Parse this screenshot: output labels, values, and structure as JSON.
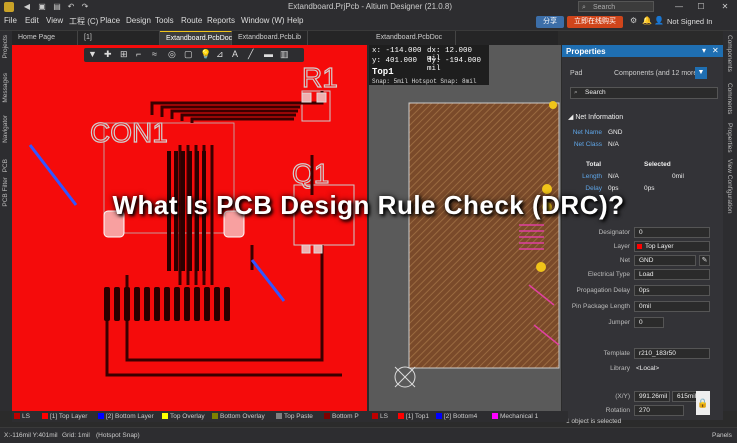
{
  "window": {
    "title": "Extandboard.PrjPcb - Altium Designer (21.0.8)",
    "search_placeholder": "Search"
  },
  "menus": [
    "File",
    "Edit",
    "View",
    "工程 (C)",
    "Place",
    "Design",
    "Tools",
    "Route",
    "Reports",
    "Window (W)",
    "Help"
  ],
  "header_buttons": {
    "share": "分享",
    "online": "立即在线购买",
    "signin": "Not Signed In"
  },
  "tabs": [
    {
      "label": "Home Page"
    },
    {
      "label": "[1] Extandboard.SchDoc *"
    },
    {
      "label": "Extandboard.PcbDoc *"
    },
    {
      "label": "Extandboard.PcbLib"
    },
    {
      "label": "Extandboard.PcbDoc"
    }
  ],
  "left_strip": [
    "Projects",
    "Messages",
    "Navigator",
    "PCB",
    "PCB Filter"
  ],
  "right_strip": [
    "Components",
    "Comments",
    "Properties",
    "View Configuration"
  ],
  "pcb_labels": {
    "con1": "CON1",
    "r1": "R1",
    "q1": "Q1"
  },
  "coords": {
    "x": "x: -114.000",
    "dx": "dx: 12.000 mil",
    "y": "y: 401.000",
    "dy": "dy: -194.000 mil",
    "layer": "Top1",
    "snap": "Snap: 5mil Hotspot Snap: 8mil"
  },
  "overlay_title": "What Is PCB Design Rule Check (DRC)?",
  "properties": {
    "header": "Properties",
    "pad_label": "Pad",
    "components": "Components (and 12 more)",
    "search": "Search",
    "net_info": "Net Information",
    "net_name_label": "Net Name",
    "net_name": "GND",
    "net_class_label": "Net Class",
    "net_class": "N/A",
    "total": "Total",
    "selected": "Selected",
    "length_label": "Length",
    "length_total": "N/A",
    "length_sel": "0mil",
    "delay_label": "Delay",
    "delay_total": "0ps",
    "delay_sel": "0ps",
    "designator_label": "Designator",
    "designator": "0",
    "layer_label": "Layer",
    "layer": "Top Layer",
    "net_label": "Net",
    "net": "GND",
    "etype_label": "Electrical Type",
    "etype": "Load",
    "pdelay_label": "Propagation Delay",
    "pdelay": "0ps",
    "plen_label": "Pin Package Length",
    "plen": "0mil",
    "jumper_label": "Jumper",
    "jumper": "0",
    "template_label": "Template",
    "template": "r210_183r50",
    "library_label": "Library",
    "library": "<Local>",
    "xy_label": "(X/Y)",
    "x": "991.26mil",
    "y": "615mil",
    "rotation_label": "Rotation",
    "rotation": "270",
    "footer": "1 object is selected"
  },
  "layers_left": [
    {
      "label": "LS",
      "color": "#c00000"
    },
    {
      "label": "[1] Top Layer",
      "color": "#ff0000"
    },
    {
      "label": "[2] Bottom Layer",
      "color": "#0000ff"
    },
    {
      "label": "Top Overlay",
      "color": "#ffff00"
    },
    {
      "label": "Bottom Overlay",
      "color": "#808000"
    },
    {
      "label": "Top Paste",
      "color": "#808080"
    },
    {
      "label": "Bottom P",
      "color": "#800000"
    }
  ],
  "layers_right": [
    {
      "label": "LS",
      "color": "#c00000"
    },
    {
      "label": "[1] Top1",
      "color": "#ff0000"
    },
    {
      "label": "[2] Bottom4",
      "color": "#0000ff"
    },
    {
      "label": "Mechanical 1",
      "color": "#ff00ff"
    }
  ],
  "status": {
    "coords": "X:-116mil Y:401mil",
    "grid": "Grid: 1mil",
    "snap": "(Hotspot Snap)",
    "panels": "Panels"
  }
}
